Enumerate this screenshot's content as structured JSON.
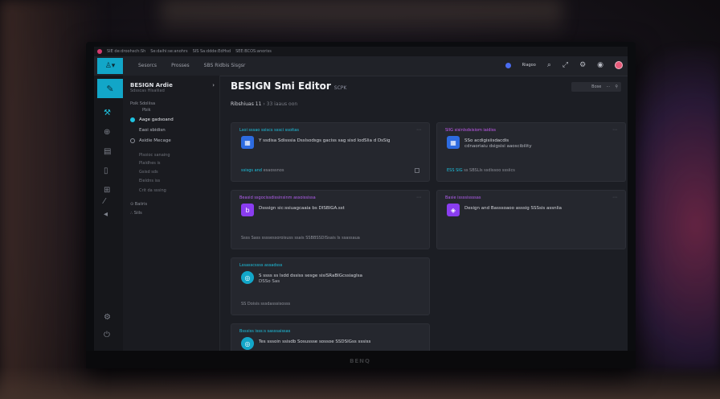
{
  "topbar": {
    "items": [
      "SIE de:droohsch:Sh",
      "Se:daihi:se:anohrs",
      "SIS Sa:ddde:EdHsd",
      "SEE:BCOS:anoriss"
    ]
  },
  "header": {
    "nav": [
      "Sesorcs",
      "Prosses",
      "SBS Ridbis Sisgsr"
    ],
    "right_label": "Riagoo"
  },
  "sidebar": {
    "title": "BESIGN Ardie",
    "subtitle": "Sdsscas Hlsaliiad",
    "section1": "Poik Sdoliisa",
    "section1_sub": "Pbik",
    "items": [
      {
        "label": "Aage gadsoand",
        "active": true
      },
      {
        "label": "Eaoi sbidisn",
        "active": false
      },
      {
        "label": "Asidie Mecage",
        "active": false
      }
    ],
    "group": [
      "Plsoioc sanaing",
      "Plaidhes is",
      "Gsisd sds",
      "Eieldns iss",
      "Crit da sssing"
    ],
    "section2": "Baiiris",
    "section2_sub": "Siils"
  },
  "main": {
    "title": "BESIGN Smi Editor",
    "title_tag": "SCPK",
    "crumb_main": "Ribshiuas 11",
    "crumb_sub": "33 iaaus oon",
    "top_btn": "Bose"
  },
  "cards": [
    {
      "head": "Lsoi sssao ssiscs sssci ssoitas",
      "line1": "Y ssdisa Sdisssia Dsslsodsgs gaciss sag sisd lodSlia d DsSig",
      "line2": "",
      "foot_hl": "ssisgs and",
      "foot": "esaossnos"
    },
    {
      "head": "SIIG sisinlsdsisiom iaidiss",
      "line1": "SSo acdigisiisdacdis",
      "line2": "cdnaoriaiu dsigsisi aaoscibility",
      "foot_hl": "ESS SIG",
      "foot": "ss  SBSLIs ssdissoo sssiics"
    },
    {
      "head": "Beasid ssgocissdissinsinm assoississa",
      "line1": "Dsssign sic:ssiuagcaaia bs DISBIGA.sst",
      "line2": "",
      "foot_hl": "",
      "foot": "Ssss  Sass ssssessoroisuss ssais  SSBBSSDISsais Is ssassaua"
    },
    {
      "head": "Basie issssissssas",
      "line1": "Design and Basssoaoo asssig SSSsis assnlia",
      "line2": "",
      "foot_hl": "",
      "foot": ""
    },
    {
      "head": "Lssasscssss assadsss",
      "line1": "S ssss ss lsdd dssiss sesge sisiSRaBIGcssiaglsa",
      "line2": "DSSo Sas",
      "foot_hl": "",
      "foot": "SS  Doisis sssdasssisosss"
    },
    {
      "head": "Bsssiss isss:s sasssaissas",
      "line1": "Tes sssoin ssisdb Sosussse sossoe SSDSIGss sssiss",
      "line2": "",
      "foot_hl": "",
      "foot": ""
    }
  ],
  "monitor": {
    "brand": "BENQ"
  },
  "colors": {
    "accent": "#12a6c8",
    "purple": "#8a3df0",
    "blue": "#2d6be0"
  }
}
